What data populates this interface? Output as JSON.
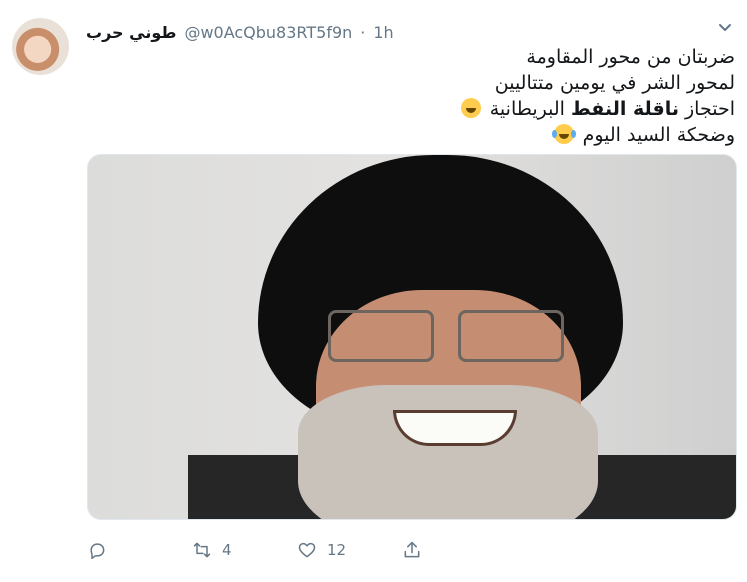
{
  "tweet": {
    "display_name": "طوني حرب",
    "handle": "@w0AcQbu83RT5f9n",
    "separator": "·",
    "time": "1h",
    "text_lines": {
      "line1": "ضربتان من محور المقاومة",
      "line2": "لمحور الشر في يومين متتاليين",
      "line3_pre": "احتجاز ",
      "line3_bold": "ناقلة النفط",
      "line3_post": " البريطانية",
      "line4": "وضحكة السيد اليوم"
    },
    "emojis": {
      "line3": "grinning-face-emoji",
      "line4": "face-with-tears-of-joy-emoji"
    }
  },
  "actions": {
    "reply": {
      "icon": "reply-icon",
      "count": ""
    },
    "retweet": {
      "icon": "retweet-icon",
      "count": "4"
    },
    "like": {
      "icon": "heart-icon",
      "count": "12"
    },
    "share": {
      "icon": "share-icon",
      "count": ""
    }
  },
  "colors": {
    "text": "#14171a",
    "secondary": "#657786",
    "border": "#e1e8ed"
  }
}
